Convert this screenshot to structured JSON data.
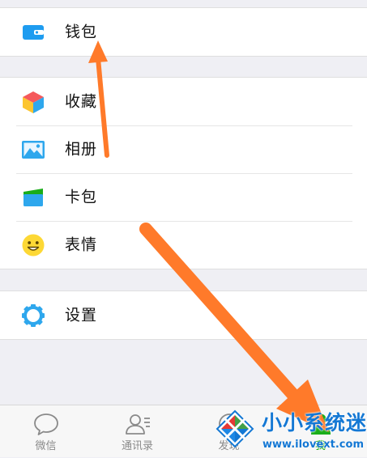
{
  "menu": {
    "wallet": {
      "label": "钱包",
      "icon": "wallet-icon"
    },
    "favorites": {
      "label": "收藏",
      "icon": "cube-icon"
    },
    "album": {
      "label": "相册",
      "icon": "photo-icon"
    },
    "cards": {
      "label": "卡包",
      "icon": "card-wallet-icon"
    },
    "stickers": {
      "label": "表情",
      "icon": "smiley-icon"
    },
    "settings": {
      "label": "设置",
      "icon": "gear-icon"
    }
  },
  "tabbar": {
    "tabs": [
      {
        "label": "微信",
        "icon": "chat-bubble-icon",
        "active": false
      },
      {
        "label": "通讯录",
        "icon": "contacts-icon",
        "active": false
      },
      {
        "label": "发现",
        "icon": "compass-icon",
        "active": false
      },
      {
        "label": "我",
        "icon": "profile-icon",
        "active": true
      }
    ]
  },
  "watermark": {
    "title": "小小系统迷",
    "url": "www.ilovext.com"
  },
  "colors": {
    "background": "#efeff4",
    "row_bg": "#ffffff",
    "accent_blue": "#1e9cf0",
    "active_green": "#1aad19",
    "arrow_orange": "#ff7a2a",
    "watermark_blue": "#1478d4"
  }
}
